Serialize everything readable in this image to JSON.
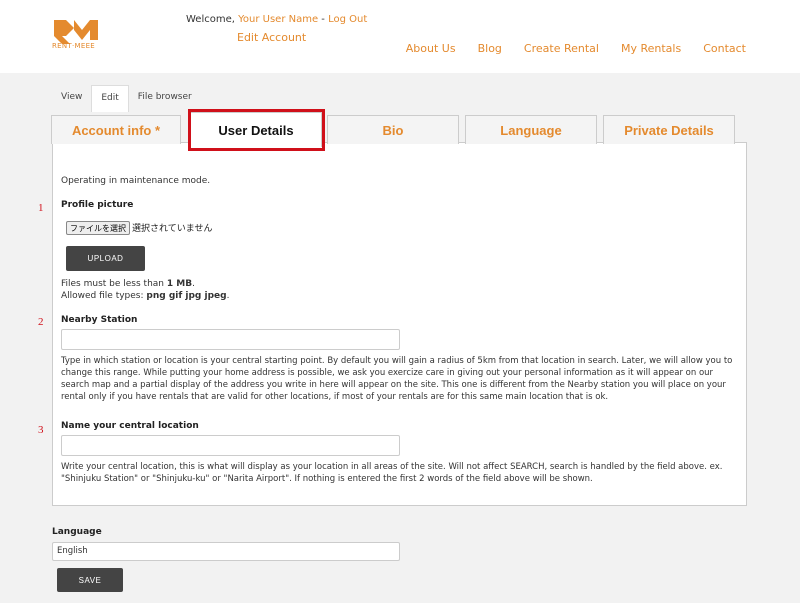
{
  "site": {
    "logo_text": "RENT·MEEE",
    "welcome_prefix": "Welcome, ",
    "user_name": "Your User Name",
    "separator": " - ",
    "logout": "Log Out",
    "edit_account": "Edit Account",
    "nav": [
      "About Us",
      "Blog",
      "Create Rental",
      "My Rentals",
      "Contact"
    ],
    "accent_color": "#e48a2e"
  },
  "local_tabs": [
    "View",
    "Edit",
    "File browser"
  ],
  "local_tabs_active": "Edit",
  "vertical_tabs": {
    "account": "Account info *",
    "user": "User Details",
    "bio": "Bio",
    "language": "Language",
    "private": "Private Details",
    "active": "User Details",
    "highlight_color": "#d0101a"
  },
  "form": {
    "maintenance": "Operating in maintenance mode.",
    "markers": [
      "1",
      "2",
      "3"
    ],
    "profile_picture_label": "Profile picture",
    "file_choose": "ファイルを選択",
    "file_status": "選択されていません",
    "upload_button": "UPLOAD",
    "file_info_prefix": "Files must be less than ",
    "file_info_size": "1 MB",
    "file_info_suffix": ".",
    "file_types_prefix": "Allowed file types: ",
    "file_types": "png gif jpg jpeg",
    "file_types_suffix": ".",
    "nearby_station_label": "Nearby Station",
    "nearby_station_value": "",
    "nearby_station_desc": "Type in which station or location is your central starting point. By default you will gain a radius of 5km from that location in search. Later, we will allow you to change this range. While putting your home address is possible, we ask you exercize care in giving out your personal information as it will appear on our search map and a partial display of the address you write in here will appear on the site. This one is different from the Nearby station you will place on your rental only if you have rentals that are valid for other locations, if most of your rentals are for this same main location that is ok.",
    "central_location_label": "Name your central location",
    "central_location_value": "",
    "central_location_desc": "Write your central location, this is what will display as your location in all areas of the site. Will not affect SEARCH, search is handled by the field above. ex. \"Shinjuku Station\" or \"Shinjuku-ku\" or \"Narita Airport\". If nothing is entered the first 2 words of the field above will be shown.",
    "language_label": "Language",
    "language_value": "English",
    "save_button": "SAVE"
  }
}
